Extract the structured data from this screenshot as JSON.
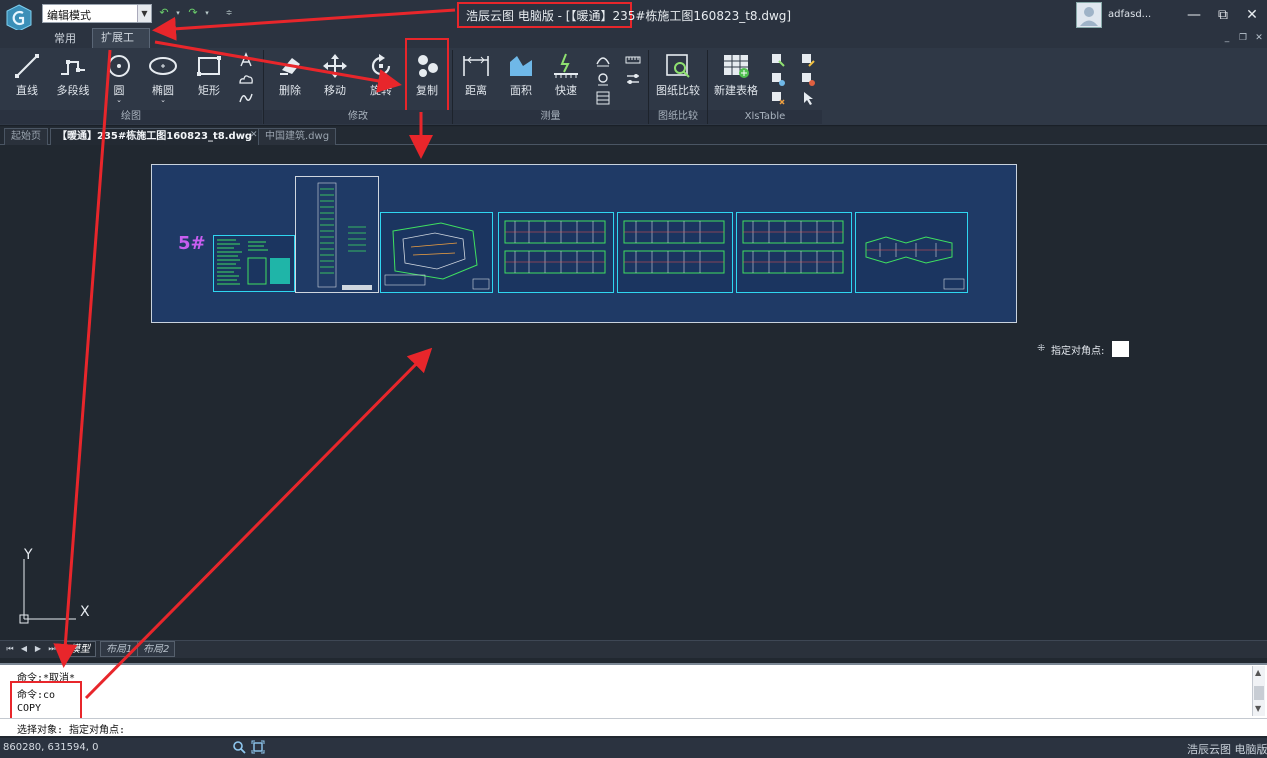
{
  "titlebar": {
    "mode": "编辑模式",
    "window_title": "浩辰云图 电脑版 - [【暖通】235#栋施工图160823_t8.dwg]",
    "user": "adfasd..."
  },
  "ribbon_tabs": [
    "常用",
    "扩展工具"
  ],
  "tools": {
    "line": "直线",
    "polyline": "多段线",
    "circle": "圆",
    "ellipse": "椭圆",
    "rect": "矩形",
    "delete": "删除",
    "move": "移动",
    "rotate": "旋转",
    "copy": "复制",
    "distance": "距离",
    "area": "面积",
    "quick": "快速",
    "compare": "图纸比较",
    "new_table": "新建表格"
  },
  "groups": {
    "draw": "绘图",
    "modify": "修改",
    "measure": "测量",
    "compare": "图纸比较",
    "xls": "XlsTable"
  },
  "doc_tabs": [
    "起始页",
    "【暖通】235#栋施工图160823_t8.dwg",
    "中国建筑.dwg"
  ],
  "drawing": {
    "building_label": "5#"
  },
  "tooltip": {
    "label": "指定对角点:"
  },
  "axis": {
    "y": "Y",
    "x": "X"
  },
  "layout_tabs": [
    "模型",
    "布局1",
    "布局2"
  ],
  "command": {
    "lines": [
      "命令:*取消*",
      "命令:co",
      "COPY"
    ],
    "prompt": "选择对象: 指定对角点:"
  },
  "status": {
    "coords": "860280, 631594, 0",
    "brand": "浩辰云图 电脑版"
  },
  "colors": {
    "accent": "#e8262b",
    "drawing_bg": "#1f3a66",
    "sheet_border": "#2fd6f0",
    "building_label": "#c85ef0"
  }
}
